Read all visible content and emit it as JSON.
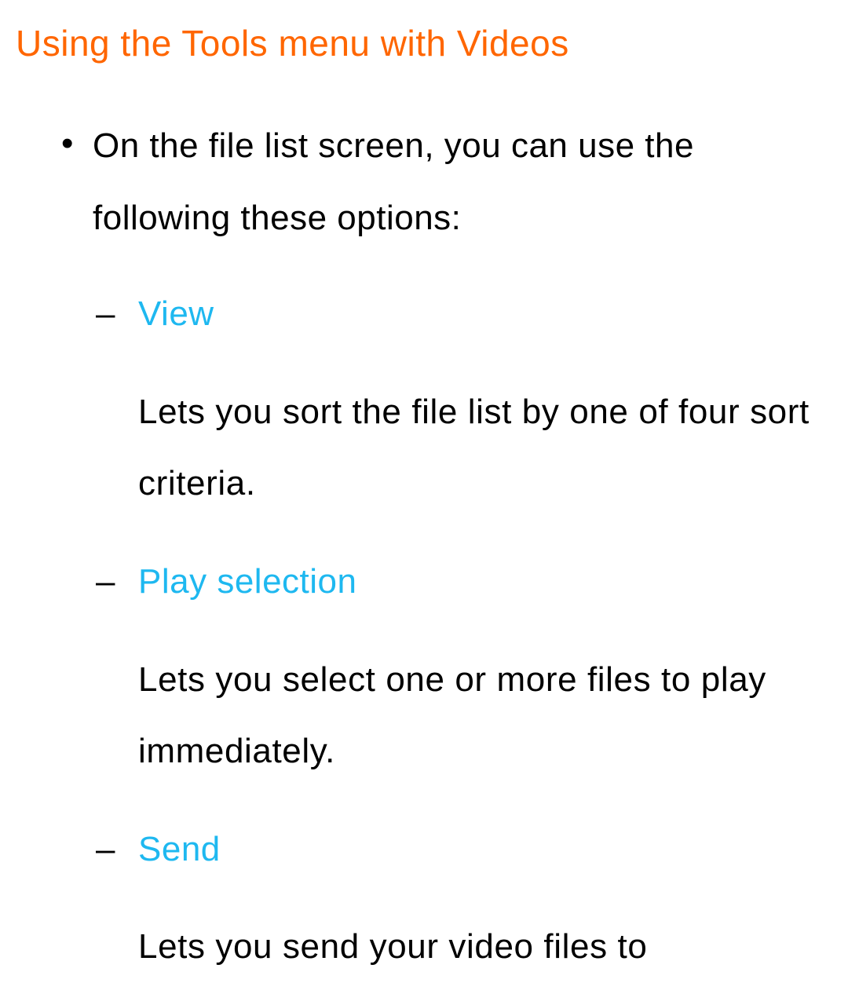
{
  "heading": "Using the Tools menu with Videos",
  "intro": "On the file list screen, you can use the following these options:",
  "items": [
    {
      "term": "View",
      "desc": "Lets you sort the file list by one of four sort criteria."
    },
    {
      "term": "Play selection",
      "desc": "Lets you select one or more files to play immediately."
    },
    {
      "term": "Send",
      "desc": "Lets you send your video files to"
    }
  ]
}
